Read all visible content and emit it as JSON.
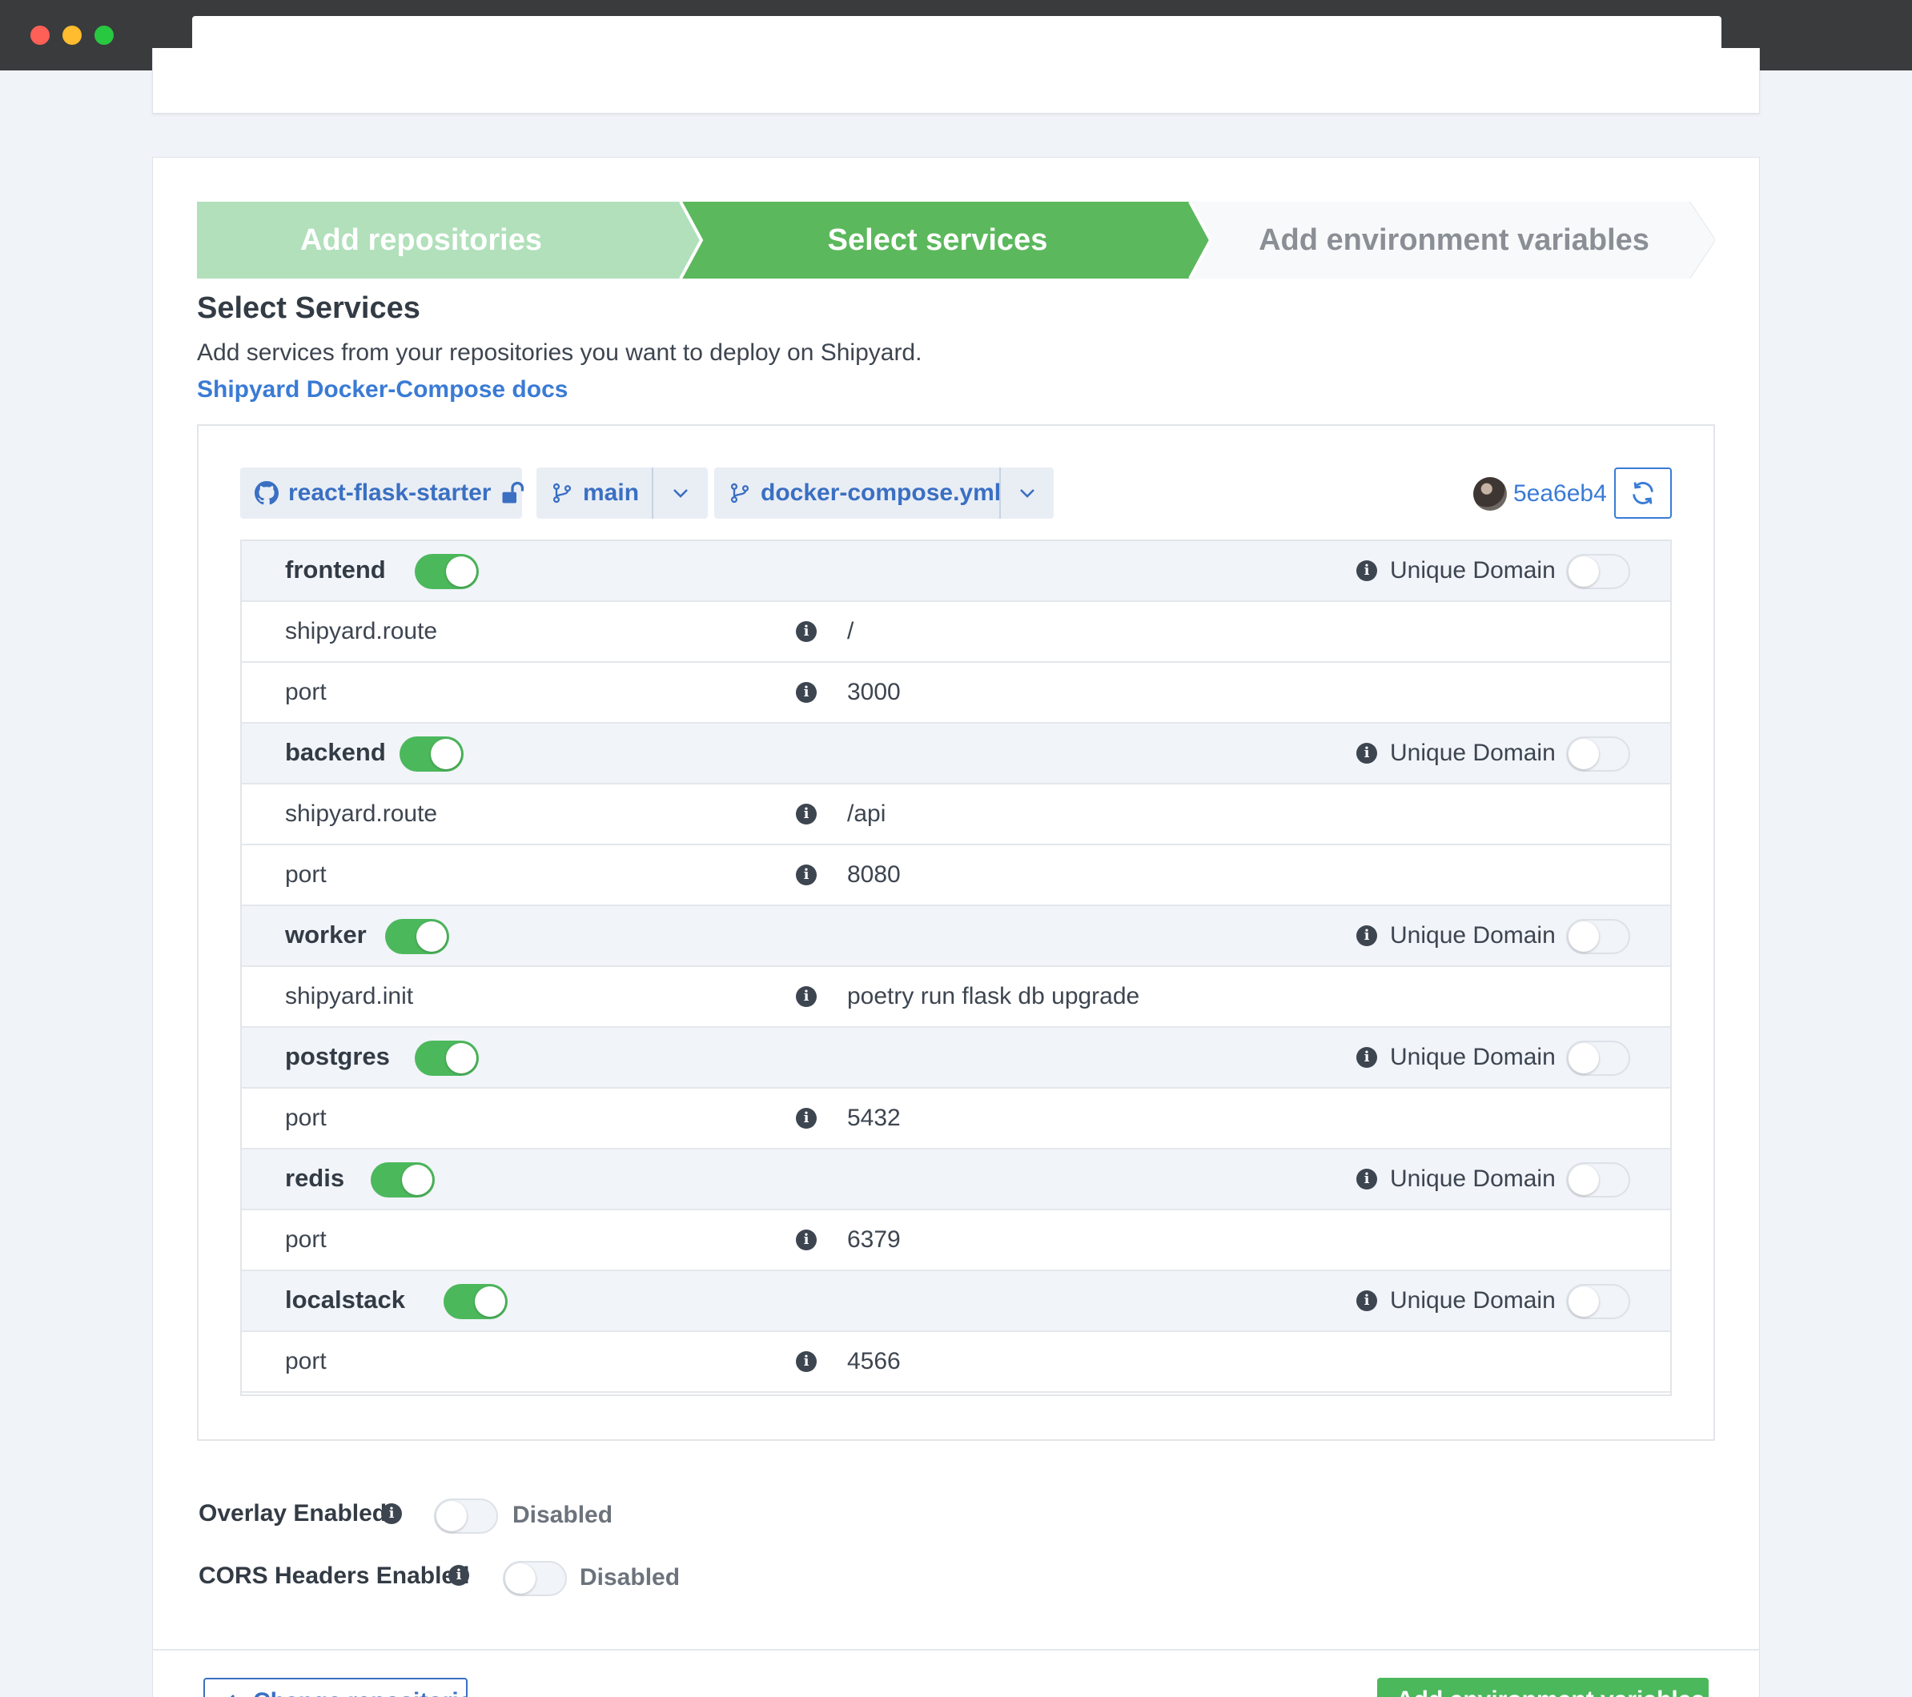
{
  "stepper": {
    "steps": [
      {
        "label": "Add repositories",
        "state": "completed"
      },
      {
        "label": "Select services",
        "state": "active"
      },
      {
        "label": "Add environment variables",
        "state": "inactive"
      }
    ]
  },
  "section": {
    "title": "Select Services",
    "description": "Add services from your repositories you want to deploy on Shipyard.",
    "docs_link": "Shipyard Docker-Compose docs"
  },
  "repo_bar": {
    "repo": "react-flask-starter",
    "branch": "main",
    "compose_file": "docker-compose.yml",
    "commit": "5ea6eb4"
  },
  "services": [
    {
      "name": "frontend",
      "enabled": true,
      "unique_domain_label": "Unique Domain",
      "unique_domain": false,
      "props": [
        {
          "key": "shipyard.route",
          "value": "/"
        },
        {
          "key": "port",
          "value": "3000"
        }
      ]
    },
    {
      "name": "backend",
      "enabled": true,
      "unique_domain_label": "Unique Domain",
      "unique_domain": false,
      "props": [
        {
          "key": "shipyard.route",
          "value": "/api"
        },
        {
          "key": "port",
          "value": "8080"
        }
      ]
    },
    {
      "name": "worker",
      "enabled": true,
      "unique_domain_label": "Unique Domain",
      "unique_domain": false,
      "props": [
        {
          "key": "shipyard.init",
          "value": "poetry run flask db upgrade"
        }
      ]
    },
    {
      "name": "postgres",
      "enabled": true,
      "unique_domain_label": "Unique Domain",
      "unique_domain": false,
      "props": [
        {
          "key": "port",
          "value": "5432"
        }
      ]
    },
    {
      "name": "redis",
      "enabled": true,
      "unique_domain_label": "Unique Domain",
      "unique_domain": false,
      "props": [
        {
          "key": "port",
          "value": "6379"
        }
      ]
    },
    {
      "name": "localstack",
      "enabled": true,
      "unique_domain_label": "Unique Domain",
      "unique_domain": false,
      "props": [
        {
          "key": "port",
          "value": "4566"
        }
      ]
    }
  ],
  "settings": {
    "overlay": {
      "label": "Overlay Enabled",
      "state": "Disabled"
    },
    "cors": {
      "label": "CORS Headers Enabled",
      "state": "Disabled"
    }
  },
  "footer": {
    "back_label": "Change repositories",
    "next_label": "Add environment variables"
  },
  "colors": {
    "step_completed": "#b1e0bb",
    "step_active": "#5cb85c",
    "step_inactive": "#f8f9fa",
    "link": "#3a7bd5",
    "toggle_on": "#4cb85c"
  }
}
